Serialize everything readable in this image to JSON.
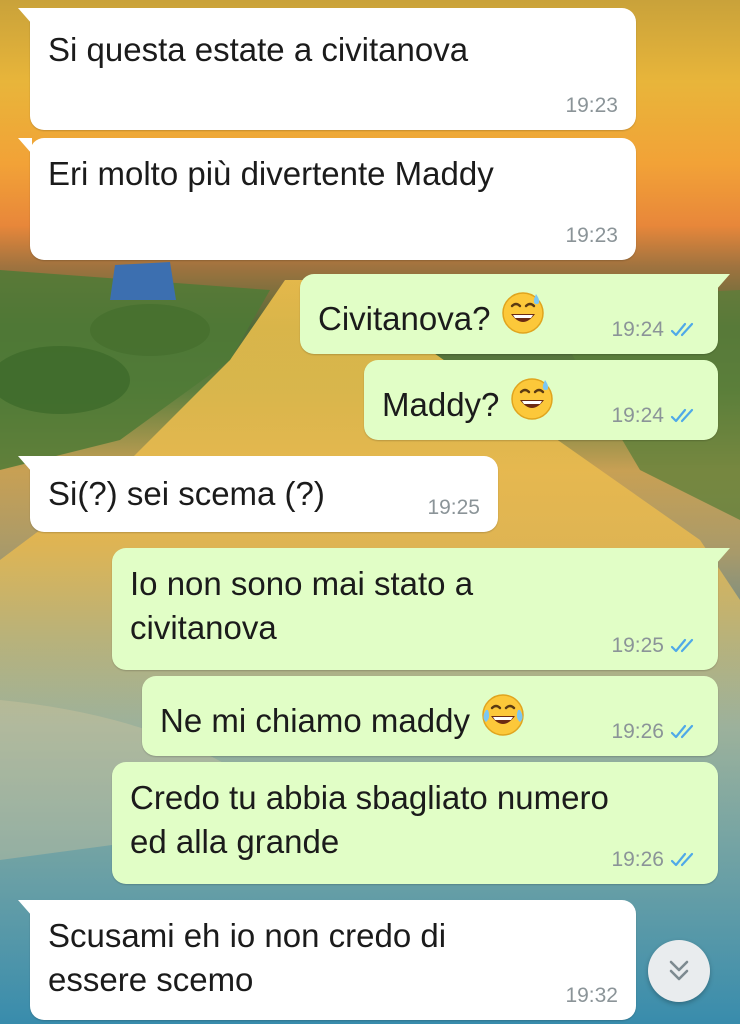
{
  "messages": [
    {
      "dir": "in",
      "text": "Si questa estate a civitanova",
      "time": "19:23"
    },
    {
      "dir": "in",
      "text": "Eri molto più divertente Maddy",
      "time": "19:23"
    },
    {
      "dir": "out",
      "text": "Civitanova?",
      "emoji": "grinning-sweat-emoji",
      "time": "19:24",
      "status": "read"
    },
    {
      "dir": "out",
      "text": "Maddy?",
      "emoji": "grinning-sweat-emoji",
      "time": "19:24",
      "status": "read"
    },
    {
      "dir": "in",
      "text": "Si(?) sei scema (?)",
      "time": "19:25"
    },
    {
      "dir": "out",
      "lines": [
        "Io non sono mai stato a",
        "civitanova"
      ],
      "time": "19:25",
      "status": "read"
    },
    {
      "dir": "out",
      "text": "Ne mi chiamo maddy",
      "emoji": "tears-of-joy-emoji",
      "time": "19:26",
      "status": "read"
    },
    {
      "dir": "out",
      "lines": [
        "Credo tu abbia sbagliato numero",
        "ed alla grande"
      ],
      "time": "19:26",
      "status": "read"
    },
    {
      "dir": "in",
      "lines": [
        "Scusami eh io non credo di",
        "essere scemo"
      ],
      "time": "19:32"
    }
  ],
  "scroll_button": {
    "icon": "double-chevron-down-icon"
  },
  "colors": {
    "incoming_bubble": "#ffffff",
    "outgoing_bubble": "#e1fec6",
    "timestamp": "#8b9498",
    "read_ticks": "#4fa9e8"
  }
}
